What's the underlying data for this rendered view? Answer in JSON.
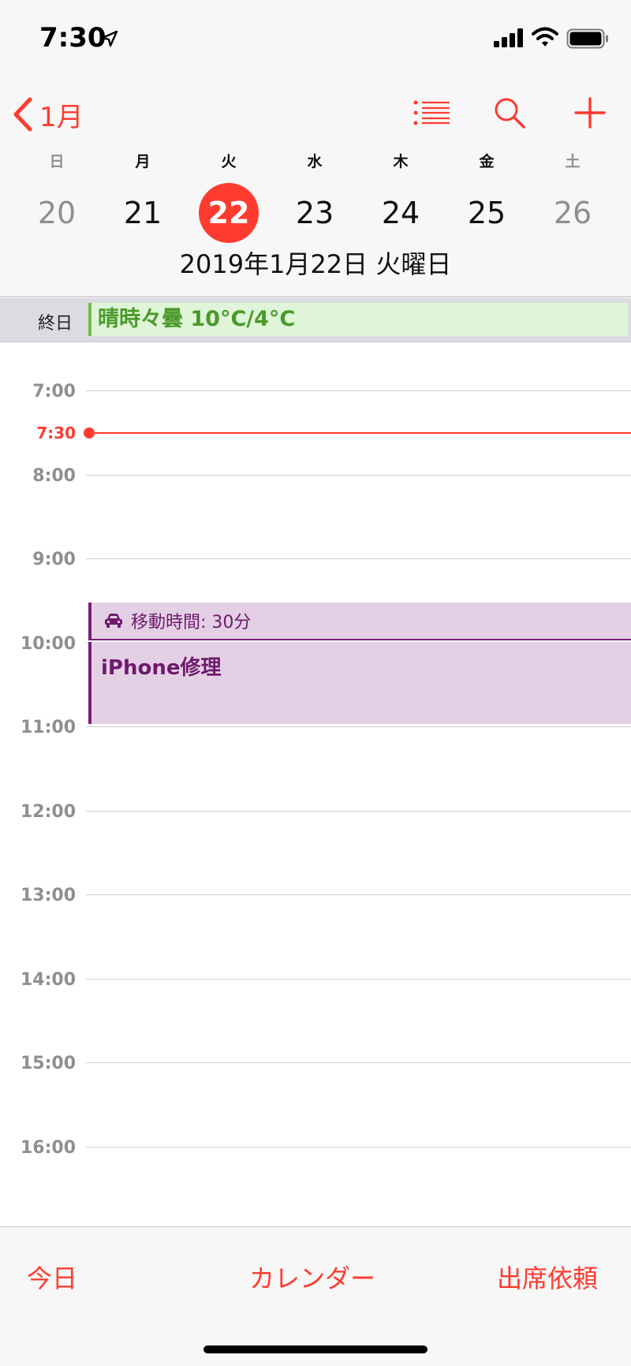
{
  "status_bar": {
    "time": "7:30"
  },
  "nav": {
    "back_label": "1月"
  },
  "week": {
    "days": [
      {
        "dow": "日",
        "num": "20"
      },
      {
        "dow": "月",
        "num": "21"
      },
      {
        "dow": "火",
        "num": "22"
      },
      {
        "dow": "水",
        "num": "23"
      },
      {
        "dow": "木",
        "num": "24"
      },
      {
        "dow": "金",
        "num": "25"
      },
      {
        "dow": "土",
        "num": "26"
      }
    ],
    "selected_day": "22"
  },
  "full_date": "2019年1月22日 火曜日",
  "all_day": {
    "label": "終日",
    "event": "晴時々曇 10°C/4°C"
  },
  "timeline": {
    "hours": [
      "7:00",
      "8:00",
      "9:00",
      "10:00",
      "11:00",
      "12:00",
      "13:00",
      "14:00",
      "15:00",
      "16:00"
    ],
    "now_label": "7:30"
  },
  "events": {
    "travel_label": "移動時間: 30分",
    "event_title": "iPhone修理"
  },
  "tabbar": {
    "today": "今日",
    "calendars": "カレンダー",
    "invites": "出席依頼"
  },
  "colors": {
    "accent": "#ff3b30",
    "event_bg": "#e4d0e4",
    "event_text": "#6e1a6e",
    "allday_bg": "#dff5d8",
    "allday_text": "#4a9a2a"
  }
}
